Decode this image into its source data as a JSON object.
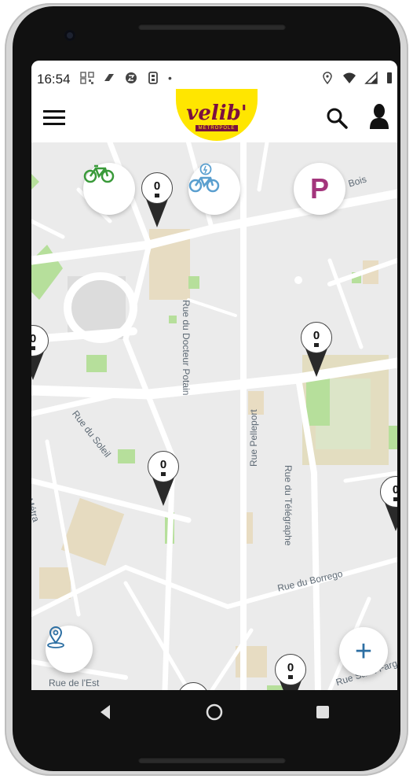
{
  "status_bar": {
    "time": "16:54",
    "left_icons": [
      "qr-code-icon",
      "tag-icon",
      "sync-icon",
      "debug-icon"
    ],
    "dot": "•",
    "right_icons": [
      "location-icon",
      "wifi-icon",
      "signal-icon",
      "battery-icon"
    ]
  },
  "app_bar": {
    "logo_text": "velib'",
    "logo_subtext": "MÉTROPOLE",
    "brand_yellow": "#ffe600",
    "brand_maroon": "#7b1040"
  },
  "filters": {
    "mechanical_bike": "bike-icon",
    "electric_bike": "electric-bike-icon",
    "parking_label": "P",
    "accent_green": "#3a9a3a",
    "accent_blue": "#5a9fcf",
    "accent_parking": "#a3357c"
  },
  "stations": [
    {
      "count": "0"
    },
    {
      "count": "0"
    },
    {
      "count": "0"
    },
    {
      "count": "0"
    },
    {
      "count": "0"
    },
    {
      "count": "0"
    }
  ],
  "streets": {
    "docteur_potain": "Rue du Docteur Potain",
    "soleil": "Rue du Soleil",
    "pelleport": "Rue Pelleport",
    "telegraphe": "Rue du Télégraphe",
    "borrego": "Rue du Borrego",
    "metra": "Olivier Métra",
    "est": "Rue de l'Est",
    "top_right": "Bois",
    "bottom_right": "Rue Saint-Fargeau"
  },
  "fabs": {
    "location_button": "location-pin-icon",
    "add_button": "+"
  },
  "nav": {
    "back": "back-icon",
    "home": "home-icon",
    "recents": "recents-icon"
  }
}
